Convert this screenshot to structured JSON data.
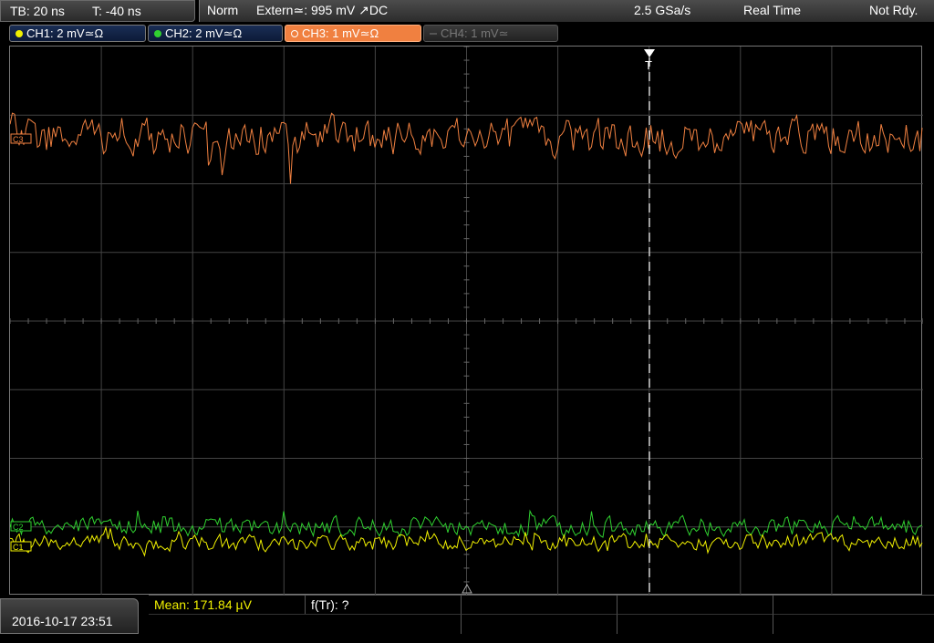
{
  "timebase": {
    "tb": "TB: 20 ns",
    "trigger_pos": "T: -40 ns"
  },
  "status": {
    "mode": "Norm",
    "trigger": "Extern≃: 995 mV ↗DC",
    "sample_rate": "2.5 GSa/s",
    "acq": "Real Time",
    "state": "Not Rdy."
  },
  "channels": [
    {
      "label": "CH1: 2 mV≃Ω",
      "color": "#f0f000",
      "state": "on"
    },
    {
      "label": "CH2: 2 mV≃Ω",
      "color": "#30d030",
      "state": "on"
    },
    {
      "label": "CH3: 1 mV≃Ω",
      "color": "#f08040",
      "state": "active"
    },
    {
      "label": "CH4: 1 mV≃",
      "color": "#888888",
      "state": "off"
    }
  ],
  "markers": {
    "c3": "C3",
    "c2": "C2",
    "c1": "C1",
    "trigger": "T"
  },
  "colors": {
    "ch1": "#f0f000",
    "ch2": "#30d030",
    "ch3": "#f08040",
    "grid": "#555555"
  },
  "footer": {
    "datetime": "2016-10-17 23:51",
    "mean": "Mean: 171.84 µV",
    "ftr": "f(Tr): ?"
  }
}
